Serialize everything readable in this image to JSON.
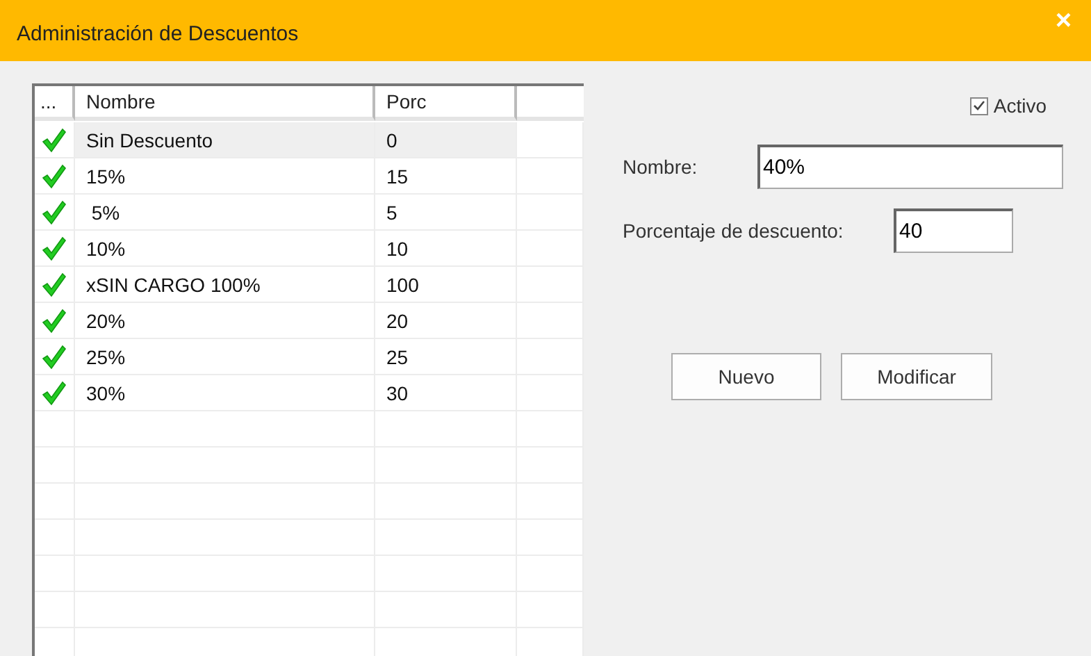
{
  "window": {
    "title": "Administración de Descuentos",
    "close": "×"
  },
  "table": {
    "columns": [
      "...",
      "Nombre",
      "Porc"
    ],
    "rows": [
      {
        "active": true,
        "selected": true,
        "nombre": "Sin Descuento",
        "porc": "0"
      },
      {
        "active": true,
        "selected": false,
        "nombre": "15%",
        "porc": "15"
      },
      {
        "active": true,
        "selected": false,
        "nombre": " 5%",
        "porc": "5"
      },
      {
        "active": true,
        "selected": false,
        "nombre": "10%",
        "porc": "10"
      },
      {
        "active": true,
        "selected": false,
        "nombre": "xSIN CARGO 100%",
        "porc": "100"
      },
      {
        "active": true,
        "selected": false,
        "nombre": "20%",
        "porc": "20"
      },
      {
        "active": true,
        "selected": false,
        "nombre": "25%",
        "porc": "25"
      },
      {
        "active": true,
        "selected": false,
        "nombre": "30%",
        "porc": "30"
      }
    ]
  },
  "form": {
    "activo": {
      "label": "Activo",
      "checked": true
    },
    "nombre": {
      "label": "Nombre:",
      "value": "40%"
    },
    "porcentaje": {
      "label": "Porcentaje de descuento:",
      "value": "40"
    },
    "buttons": [
      "Nuevo",
      "Modificar"
    ]
  }
}
